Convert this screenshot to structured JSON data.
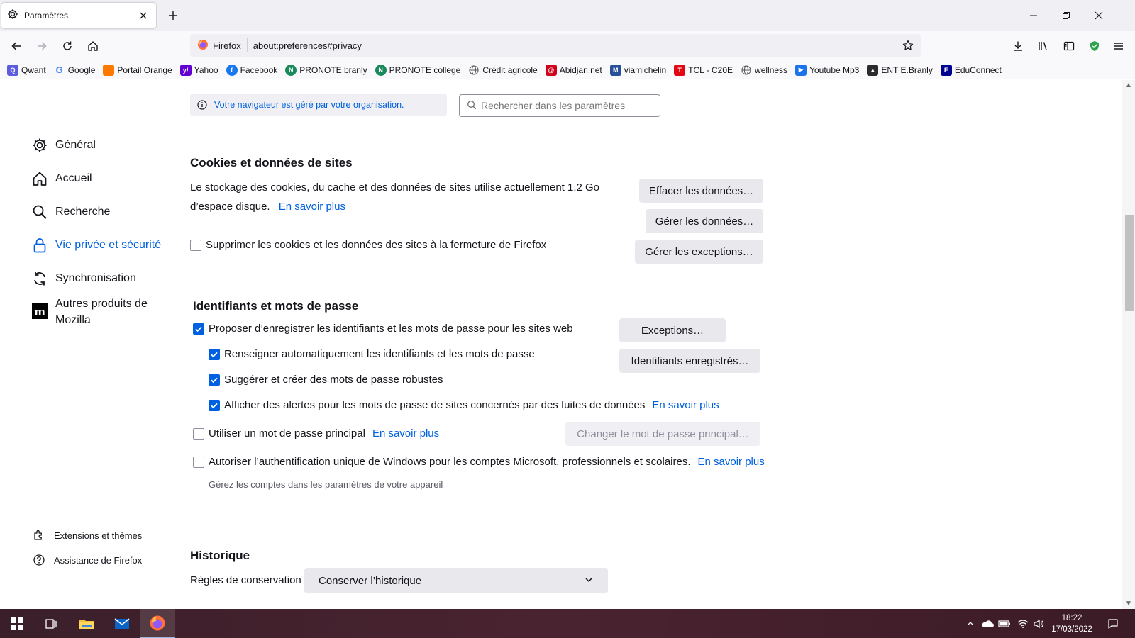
{
  "window": {
    "tab_title": "Paramètres",
    "url_identity": "Firefox",
    "url": "about:preferences#privacy"
  },
  "bookmarks": [
    {
      "label": "Qwant",
      "icon": "qwant-icon",
      "color": "#5c5cde"
    },
    {
      "label": "Google",
      "icon": "google-icon",
      "color": "#4285f4"
    },
    {
      "label": "Portail Orange",
      "icon": "orange-icon",
      "color": "#ff7900"
    },
    {
      "label": "Yahoo",
      "icon": "yahoo-icon",
      "color": "#6001d2"
    },
    {
      "label": "Facebook",
      "icon": "facebook-icon",
      "color": "#1877f2"
    },
    {
      "label": "PRONOTE branly",
      "icon": "pronote-icon",
      "color": "#1b8a5a"
    },
    {
      "label": "PRONOTE college",
      "icon": "pronote-icon",
      "color": "#1b8a5a"
    },
    {
      "label": "Crédit agricole",
      "icon": "globe-icon",
      "color": "#555555"
    },
    {
      "label": "Abidjan.net",
      "icon": "abidjan-icon",
      "color": "#d0021b"
    },
    {
      "label": "viamichelin",
      "icon": "michelin-icon",
      "color": "#27509b"
    },
    {
      "label": "TCL - C20E",
      "icon": "tcl-icon",
      "color": "#e30613"
    },
    {
      "label": "wellness",
      "icon": "globe-icon",
      "color": "#555555"
    },
    {
      "label": "Youtube Mp3",
      "icon": "youtube-icon",
      "color": "#1a73e8"
    },
    {
      "label": "ENT E.Branly",
      "icon": "ent-icon",
      "color": "#2b2b2b"
    },
    {
      "label": "EduConnect",
      "icon": "educonnect-icon",
      "color": "#000091"
    }
  ],
  "sidebar": {
    "items": [
      {
        "label": "Général",
        "icon": "gear-icon"
      },
      {
        "label": "Accueil",
        "icon": "home-icon"
      },
      {
        "label": "Recherche",
        "icon": "search-icon"
      },
      {
        "label": "Vie privée et sécurité",
        "icon": "lock-icon",
        "active": true
      },
      {
        "label": "Synchronisation",
        "icon": "sync-icon"
      },
      {
        "label": "Autres produits de",
        "label2": "Mozilla",
        "icon": "mozilla-icon"
      }
    ],
    "footer": [
      {
        "label": "Extensions et thèmes",
        "icon": "puzzle-icon"
      },
      {
        "label": "Assistance de Firefox",
        "icon": "help-icon"
      }
    ]
  },
  "policy_notice": "Votre navigateur est géré par votre organisation.",
  "search": {
    "placeholder": "Rechercher dans les paramètres"
  },
  "cookies": {
    "heading": "Cookies et données de sites",
    "description_line1": "Le stockage des cookies, du cache et des données de sites utilise actuellement 1,2 Go",
    "description_line2": "d’espace disque.",
    "learn_more": "En savoir plus",
    "clear_button": "Effacer les données…",
    "manage_button": "Gérer les données…",
    "exceptions_button": "Gérer les exceptions…",
    "delete_on_close": {
      "label": "Supprimer les cookies et les données des sites à la fermeture de Firefox",
      "checked": false
    }
  },
  "logins": {
    "heading": "Identifiants et mots de passe",
    "ask_to_save": {
      "label": "Proposer d’enregistrer les identifiants et les mots de passe pour les sites web",
      "checked": true
    },
    "autofill": {
      "label": "Renseigner automatiquement les identifiants et les mots de passe",
      "checked": true
    },
    "suggest": {
      "label": "Suggérer et créer des mots de passe robustes",
      "checked": true
    },
    "breach_alerts": {
      "label": "Afficher des alertes pour les mots de passe de sites concernés par des fuites de données",
      "checked": true,
      "link": "En savoir plus"
    },
    "primary_password": {
      "label": "Utiliser un mot de passe principal",
      "checked": false,
      "link": "En savoir plus"
    },
    "windows_sso": {
      "label": "Autoriser l’authentification unique de Windows pour les comptes Microsoft, professionnels et scolaires.",
      "checked": false,
      "link": "En savoir plus"
    },
    "windows_hint": "Gérez les comptes dans les paramètres de votre appareil",
    "exceptions_button": "Exceptions…",
    "saved_logins_button": "Identifiants enregistrés…",
    "change_primary_button": "Changer le mot de passe principal…"
  },
  "history": {
    "heading": "Historique",
    "rules_label": "Règles de conservation",
    "rules_value": "Conserver l’historique"
  },
  "taskbar": {
    "time": "18:22",
    "date": "17/03/2022"
  },
  "colors": {
    "accent": "#0061e0",
    "taskbar": "#3a1f2a"
  }
}
